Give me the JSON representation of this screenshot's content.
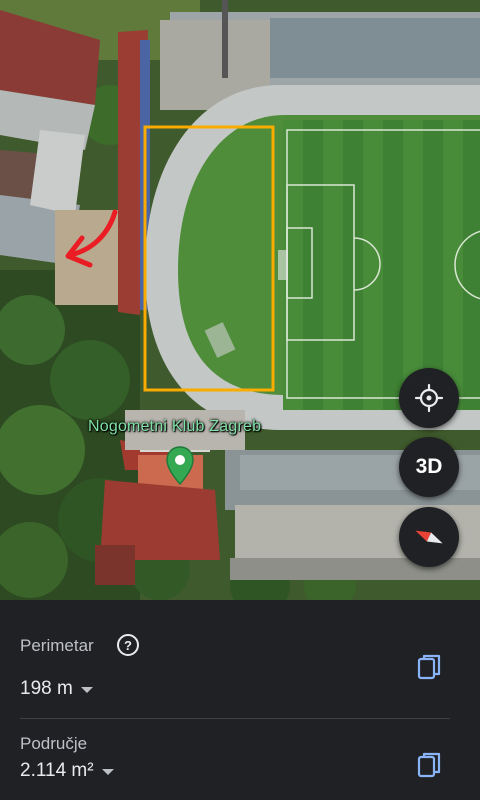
{
  "map": {
    "poi_label": "Nogometni Klub Zagreb",
    "pin_color": "#34a853",
    "outline_color": "#f9ab00",
    "arrow_color": "#ea1c24"
  },
  "controls": {
    "locate_icon": "crosshair-icon",
    "threed_label": "3D",
    "compass_icon": "compass-icon"
  },
  "panel": {
    "perimeter_label": "Perimetar",
    "perimeter_value": "198 m",
    "area_label": "Područje",
    "area_value": "2.114 m²",
    "help_icon": "help-circle-icon",
    "copy_icon": "copy-icon"
  }
}
